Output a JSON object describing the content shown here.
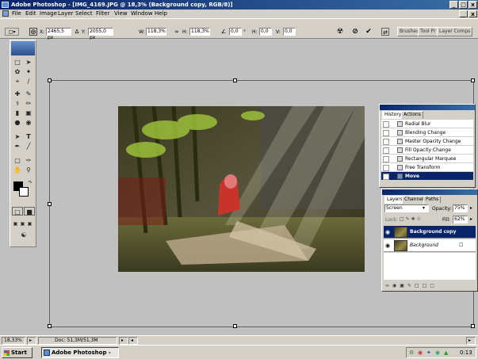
{
  "window": {
    "title": "Adobe Photoshop - [IMG_4169.JPG @ 18,3% (Background copy, RGB/8)]",
    "minimize_label": "_",
    "restore_label": "□",
    "close_label": "x"
  },
  "menu": {
    "items": [
      "File",
      "Edit",
      "Image",
      "Layer",
      "Select",
      "Filter",
      "View",
      "Window",
      "Help"
    ]
  },
  "options": {
    "x_label": "X:",
    "x_value": "2465,5 px",
    "y_label": "Y:",
    "y_value": "2055,0 px",
    "w_label": "W:",
    "w_value": "118,3%",
    "h_label": "H:",
    "h_value": "118,3%",
    "angle_value": "0,0",
    "h_skew_label": "H:",
    "h_skew_value": "0,0",
    "v_skew_label": "V:",
    "v_skew_value": "0,0",
    "palette_tabs": [
      "Brushes",
      "Tool Pr",
      "Layer Comps"
    ]
  },
  "history": {
    "tabs": [
      "History",
      "Actions"
    ],
    "items": [
      "Radial Blur",
      "Blending Change",
      "Master Opacity Change",
      "Fill Opacity Change",
      "Rectangular Marquee",
      "Free Transform",
      "Move"
    ]
  },
  "layers": {
    "tabs": [
      "Layers",
      "Channels",
      "Paths"
    ],
    "blend_mode": "Screen",
    "opacity_label": "Opacity:",
    "opacity_value": "75%",
    "lock_label": "Lock:",
    "fill_label": "Fill:",
    "fill_value": "62%",
    "items": [
      "Background copy",
      "Background"
    ]
  },
  "status": {
    "zoom": "18,33%",
    "doc": "Doc: 51,3M/51,3M"
  },
  "taskbar": {
    "start_label": "Start",
    "task_label": "Adobe Photoshop - [I...",
    "clock": "0:13"
  },
  "colors": {
    "titlebar": "#0a246a",
    "chrome": "#d4d0c8",
    "workspace": "#c0c0c0",
    "selection": "#0a246a"
  }
}
